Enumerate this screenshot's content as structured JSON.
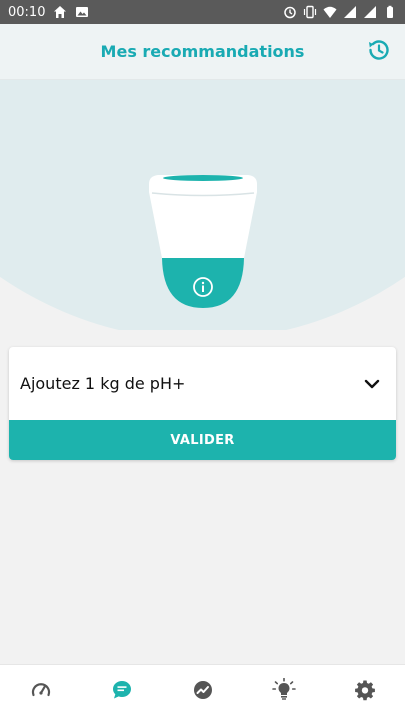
{
  "status_bar": {
    "time": "00:10",
    "icons": [
      "home-icon",
      "image-icon",
      "alarm-icon",
      "vibrate-icon",
      "wifi-icon",
      "signal-icon",
      "signal-icon",
      "battery-icon"
    ]
  },
  "header": {
    "title": "Mes recommandations",
    "history_icon": "history-icon"
  },
  "recommendation": {
    "text": "Ajoutez 1 kg de pH+",
    "dropdown_icon": "chevron-down-icon",
    "validate_label": "VALIDER"
  },
  "bottom_nav": {
    "items": [
      {
        "icon": "gauge-icon",
        "active": false
      },
      {
        "icon": "chat-bubble-icon",
        "active": true
      },
      {
        "icon": "trend-chart-icon",
        "active": false
      },
      {
        "icon": "lightbulb-icon",
        "active": false
      },
      {
        "icon": "gear-icon",
        "active": false
      }
    ]
  },
  "colors": {
    "accent": "#1db3ad",
    "title": "#19aab3",
    "arc": "#e0ecee",
    "inactive_icon": "#555555"
  }
}
